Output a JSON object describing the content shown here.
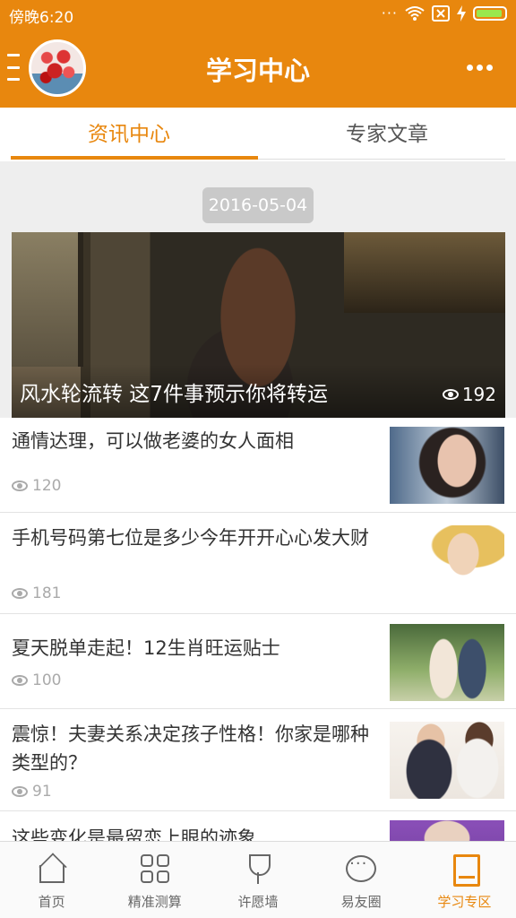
{
  "status_bar": {
    "time": "傍晚6:20",
    "more": "···"
  },
  "app_bar": {
    "title": "学习中心"
  },
  "tabs": [
    {
      "label": "资讯中心",
      "active": true
    },
    {
      "label": "专家文章",
      "active": false
    }
  ],
  "date_chip": "2016-05-04",
  "hero": {
    "title": "风水轮流转 这7件事预示你将转运",
    "views": "192"
  },
  "articles": [
    {
      "title": "通情达理，可以做老婆的女人面相",
      "views": "120"
    },
    {
      "title": "手机号码第七位是多少今年开开心心发大财",
      "views": "181"
    },
    {
      "title": "夏天脱单走起！12生肖旺运贴士",
      "views": "100"
    },
    {
      "title": "震惊！夫妻关系决定孩子性格！你家是哪种类型的？",
      "views": "91"
    },
    {
      "title": "这些变化是最留恋上眼的迹象",
      "views": ""
    }
  ],
  "bottom_nav": [
    {
      "label": "首页",
      "icon": "home-icon"
    },
    {
      "label": "精准测算",
      "icon": "grid-icon"
    },
    {
      "label": "许愿墙",
      "icon": "tulip-icon"
    },
    {
      "label": "易友圈",
      "icon": "chat-icon"
    },
    {
      "label": "学习专区",
      "icon": "book-icon",
      "active": true
    }
  ],
  "colors": {
    "accent": "#E8870E",
    "content_bg": "#EEEEEE",
    "date_chip": "#C9C9C9"
  }
}
